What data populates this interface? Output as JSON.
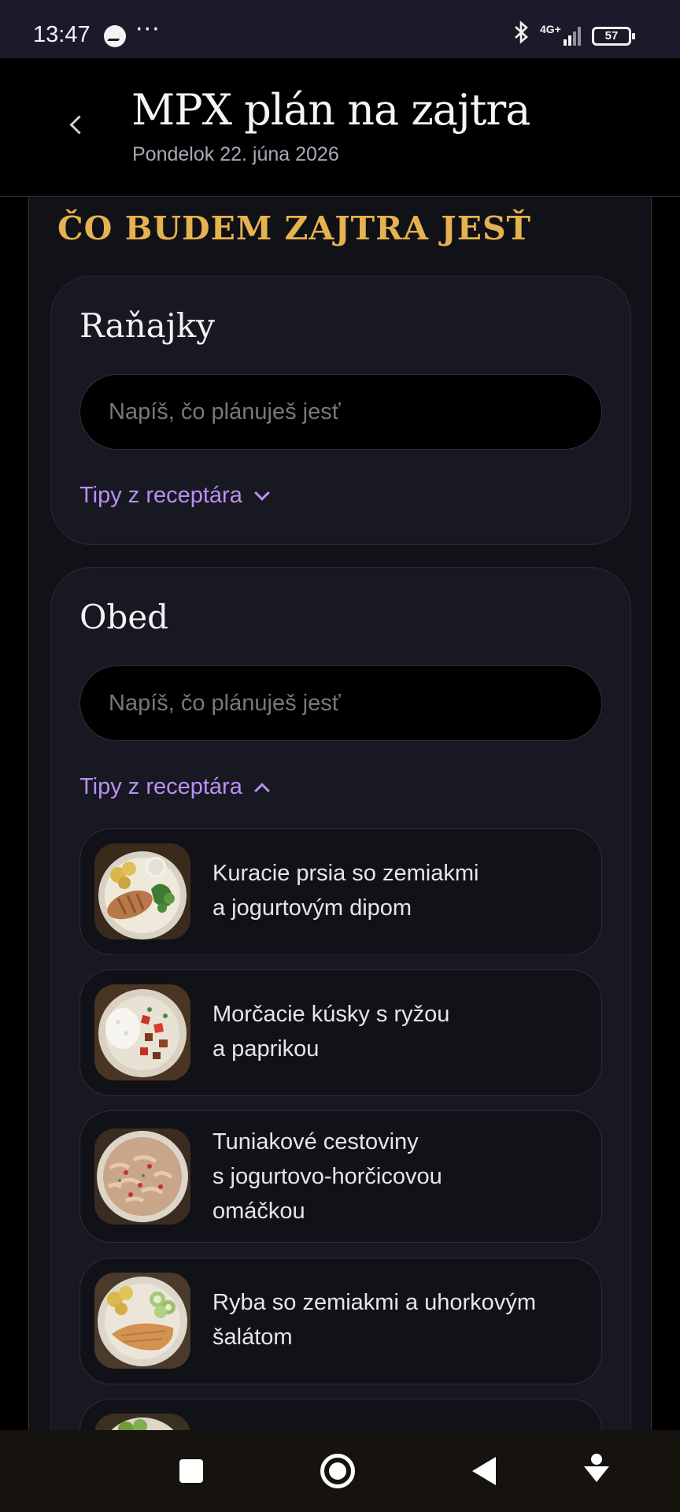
{
  "status_bar": {
    "time": "13:47",
    "dots": "···",
    "network": "4G+",
    "battery": "57"
  },
  "header": {
    "title": "MPX plán na zajtra",
    "date": "Pondelok 22. júna 2026"
  },
  "section": {
    "title": "ČO BUDEM ZAJTRA JESŤ"
  },
  "meals": [
    {
      "title": "Raňajky",
      "placeholder": "Napíš, čo plánuješ jesť",
      "tips_label": "Tipy z receptára",
      "expanded": false
    },
    {
      "title": "Obed",
      "placeholder": "Napíš, čo plánuješ jesť",
      "tips_label": "Tipy z receptára",
      "expanded": true,
      "recipes": [
        {
          "name_line1": "Kuracie prsia so zemiakmi",
          "name_line2": "a jogurtovým dipom",
          "name_line3": ""
        },
        {
          "name_line1": "Morčacie kúsky s ryžou",
          "name_line2": "a paprikou",
          "name_line3": ""
        },
        {
          "name_line1": "Tuniakové cestoviny",
          "name_line2": "s jogurtovo-horčicovou",
          "name_line3": "omáčkou"
        },
        {
          "name_line1": "Ryba so zemiakmi a uhorkovým",
          "name_line2": "šalátom",
          "name_line3": ""
        }
      ]
    }
  ],
  "colors": {
    "accent_gold": "#e5b24f",
    "accent_purple": "#b890f2",
    "background": "#000000",
    "card": "#181822"
  },
  "icons": {
    "back": "chevron-left-icon",
    "tips_collapsed": "chevron-down-icon",
    "tips_expanded": "chevron-up-icon"
  }
}
